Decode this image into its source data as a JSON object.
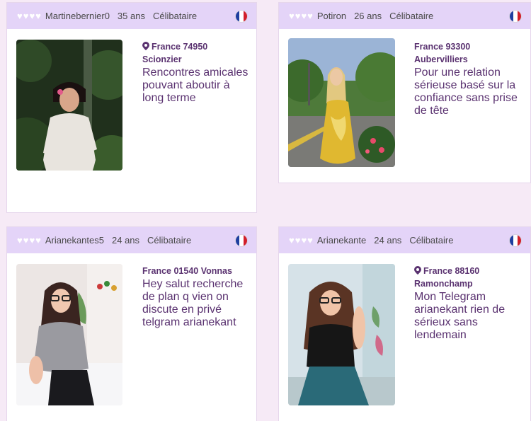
{
  "colors": {
    "header_bg": "#e4d4f8",
    "text_purple": "#5a3270",
    "page_bg": "#f6eaf6"
  },
  "icons": {
    "like": "heart-icon",
    "location": "location-pin-icon",
    "flag": "france-flag-icon"
  },
  "profiles": [
    {
      "username": "Martinebernier0",
      "age": "35 ans",
      "status": "Célibataire",
      "loc_line1": "France 74950",
      "loc_line2": "Scionzier",
      "description": "Rencontres amicales pouvant aboutir à long terme",
      "has_pin": true
    },
    {
      "username": "Potiron",
      "age": "26 ans",
      "status": "Célibataire",
      "loc_line1": "France 93300",
      "loc_line2": "Aubervilliers",
      "description": "Pour une relation sérieuse basé sur la confiance sans prise de tête",
      "has_pin": false
    },
    {
      "username": "Arianekantes5",
      "age": "24 ans",
      "status": "Célibataire",
      "loc_line1": "France 01540 Vonnas",
      "loc_line2": "",
      "description": "Hey salut recherche de plan q vien on discute en privé telgram arianekant",
      "has_pin": false
    },
    {
      "username": "Arianekante",
      "age": "24 ans",
      "status": "Célibataire",
      "loc_line1": "France 88160",
      "loc_line2": "Ramonchamp",
      "description": "Mon Telegram arianekant rien de sérieux sans lendemain",
      "has_pin": true
    }
  ]
}
